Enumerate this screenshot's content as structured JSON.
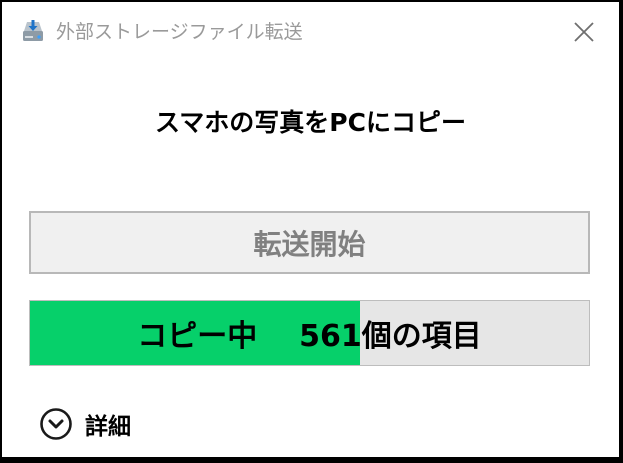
{
  "window": {
    "title": "外部ストレージファイル転送",
    "icon": "download-drive-icon",
    "close_icon": "close-icon"
  },
  "main": {
    "heading": "スマホの写真をPCにコピー",
    "start_button_label": "転送開始",
    "progress": {
      "label": "コピー中    561個の項目",
      "fraction": 0.59,
      "fill_color": "#06d06a",
      "track_color": "#e6e6e6"
    },
    "details": {
      "label": "詳細",
      "icon": "chevron-down-circle-icon"
    }
  }
}
